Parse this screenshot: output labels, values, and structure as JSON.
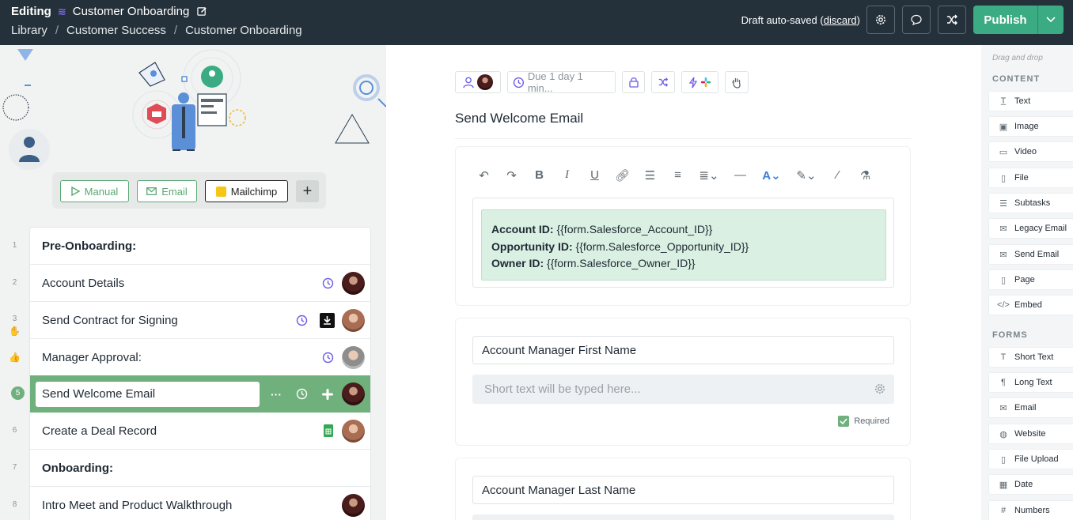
{
  "header": {
    "mode": "Editing",
    "workflow_title": "Customer Onboarding",
    "breadcrumb": [
      "Library",
      "Customer Success",
      "Customer Onboarding"
    ],
    "draft_text": "Draft auto-saved",
    "discard_label": "discard",
    "publish_label": "Publish"
  },
  "triggers": {
    "manual": "Manual",
    "email": "Email",
    "mailchimp": "Mailchimp",
    "add": "+"
  },
  "tasks": [
    {
      "num": "1",
      "name": "Pre-Onboarding:",
      "heading": true
    },
    {
      "num": "2",
      "name": "Account Details"
    },
    {
      "num": "3",
      "name": "Send Contract for Signing"
    },
    {
      "num": "",
      "name": "Manager Approval:"
    },
    {
      "num": "5",
      "name": "Send Welcome Email",
      "active": true
    },
    {
      "num": "6",
      "name": "Create a Deal Record"
    },
    {
      "num": "7",
      "name": "Onboarding:",
      "heading": true
    },
    {
      "num": "8",
      "name": "Intro Meet and Product Walkthrough"
    }
  ],
  "task_toolbar": {
    "due_label": "Due 1 day 1 min..."
  },
  "task_detail": {
    "title": "Send Welcome Email",
    "callout": [
      {
        "label": "Account ID:",
        "value": " {{form.Salesforce_Account_ID}}"
      },
      {
        "label": "Opportunity ID:",
        "value": " {{form.Salesforce_Opportunity_ID}}"
      },
      {
        "label": "Owner ID:",
        "value": " {{form.Salesforce_Owner_ID}}"
      }
    ],
    "field1": {
      "label": "Account Manager First Name",
      "placeholder": "Short text will be typed here...",
      "required_label": "Required"
    },
    "field2": {
      "label": "Account Manager Last Name"
    }
  },
  "sidebar": {
    "drag_hint": "Drag and drop",
    "content_heading": "CONTENT",
    "content_items": [
      "Text",
      "Image",
      "Video",
      "File",
      "Subtasks",
      "Legacy Email",
      "Send Email",
      "Page",
      "Embed"
    ],
    "forms_heading": "FORMS",
    "form_items": [
      "Short Text",
      "Long Text",
      "Email",
      "Website",
      "File Upload",
      "Date",
      "Numbers"
    ]
  },
  "colors": {
    "header_bg": "#24313a",
    "publish": "#3aab82",
    "accent_green": "#6fb07d",
    "callout_bg": "#daf0e3",
    "accent_purple": "#6c5ce7"
  }
}
